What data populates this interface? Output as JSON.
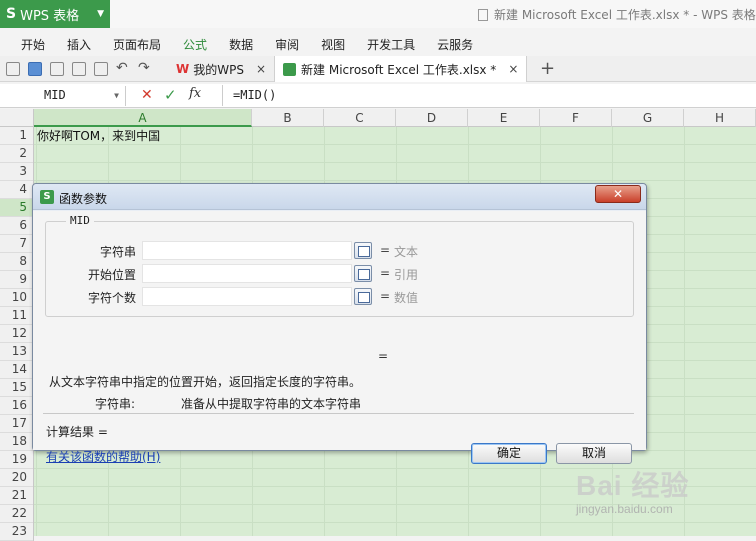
{
  "app": {
    "name": "WPS 表格",
    "logo": "S",
    "window_title": "新建 Microsoft Excel 工作表.xlsx * - WPS 表格"
  },
  "menu": {
    "tabs": [
      "开始",
      "插入",
      "页面布局",
      "公式",
      "数据",
      "审阅",
      "视图",
      "开发工具",
      "云服务"
    ],
    "active": "公式"
  },
  "doc_tabs": [
    {
      "label": "我的WPS",
      "active": false
    },
    {
      "label": "新建 Microsoft Excel 工作表.xlsx *",
      "active": true
    }
  ],
  "formula_bar": {
    "name_box": "MID",
    "fx": "fx",
    "formula": "=MID()"
  },
  "grid": {
    "columns": [
      "A",
      "B",
      "C",
      "D",
      "E",
      "F",
      "G",
      "H"
    ],
    "active_column": "A",
    "rows": [
      "1",
      "2",
      "3",
      "4",
      "5",
      "6",
      "7",
      "8",
      "9",
      "10",
      "11",
      "12",
      "13",
      "14",
      "15",
      "16",
      "17",
      "18",
      "19",
      "20",
      "21",
      "22",
      "23"
    ],
    "active_row": "5",
    "cell_A1": "你好啊TOM，来到中国"
  },
  "dialog": {
    "title": "函数参数",
    "close": "✕",
    "function_name": "MID",
    "args": [
      {
        "label": "字符串",
        "value": "",
        "eq": "=",
        "hint": "文本"
      },
      {
        "label": "开始位置",
        "value": "",
        "eq": "=",
        "hint": "引用"
      },
      {
        "label": "字符个数",
        "value": "",
        "eq": "=",
        "hint": "数值"
      }
    ],
    "result_eq": "=",
    "description": "从文本字符串中指定的位置开始，返回指定长度的字符串。",
    "arg_desc_label": "字符串:",
    "arg_desc_text": "准备从中提取字符串的文本字符串",
    "calc_result": "计算结果 =",
    "help_link": "有关该函数的帮助(H)",
    "ok": "确定",
    "cancel": "取消"
  },
  "watermark": {
    "text": "Bai 经验",
    "sub": "jingyan.baidu.com"
  }
}
